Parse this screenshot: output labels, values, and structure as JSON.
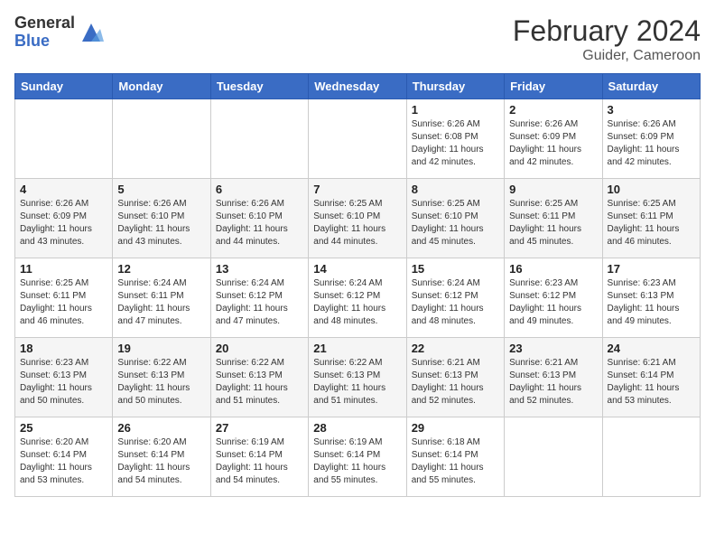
{
  "header": {
    "logo_general": "General",
    "logo_blue": "Blue",
    "title": "February 2024",
    "subtitle": "Guider, Cameroon"
  },
  "days_of_week": [
    "Sunday",
    "Monday",
    "Tuesday",
    "Wednesday",
    "Thursday",
    "Friday",
    "Saturday"
  ],
  "weeks": [
    [
      {
        "day": "",
        "info": ""
      },
      {
        "day": "",
        "info": ""
      },
      {
        "day": "",
        "info": ""
      },
      {
        "day": "",
        "info": ""
      },
      {
        "day": "1",
        "info": "Sunrise: 6:26 AM\nSunset: 6:08 PM\nDaylight: 11 hours\nand 42 minutes."
      },
      {
        "day": "2",
        "info": "Sunrise: 6:26 AM\nSunset: 6:09 PM\nDaylight: 11 hours\nand 42 minutes."
      },
      {
        "day": "3",
        "info": "Sunrise: 6:26 AM\nSunset: 6:09 PM\nDaylight: 11 hours\nand 42 minutes."
      }
    ],
    [
      {
        "day": "4",
        "info": "Sunrise: 6:26 AM\nSunset: 6:09 PM\nDaylight: 11 hours\nand 43 minutes."
      },
      {
        "day": "5",
        "info": "Sunrise: 6:26 AM\nSunset: 6:10 PM\nDaylight: 11 hours\nand 43 minutes."
      },
      {
        "day": "6",
        "info": "Sunrise: 6:26 AM\nSunset: 6:10 PM\nDaylight: 11 hours\nand 44 minutes."
      },
      {
        "day": "7",
        "info": "Sunrise: 6:25 AM\nSunset: 6:10 PM\nDaylight: 11 hours\nand 44 minutes."
      },
      {
        "day": "8",
        "info": "Sunrise: 6:25 AM\nSunset: 6:10 PM\nDaylight: 11 hours\nand 45 minutes."
      },
      {
        "day": "9",
        "info": "Sunrise: 6:25 AM\nSunset: 6:11 PM\nDaylight: 11 hours\nand 45 minutes."
      },
      {
        "day": "10",
        "info": "Sunrise: 6:25 AM\nSunset: 6:11 PM\nDaylight: 11 hours\nand 46 minutes."
      }
    ],
    [
      {
        "day": "11",
        "info": "Sunrise: 6:25 AM\nSunset: 6:11 PM\nDaylight: 11 hours\nand 46 minutes."
      },
      {
        "day": "12",
        "info": "Sunrise: 6:24 AM\nSunset: 6:11 PM\nDaylight: 11 hours\nand 47 minutes."
      },
      {
        "day": "13",
        "info": "Sunrise: 6:24 AM\nSunset: 6:12 PM\nDaylight: 11 hours\nand 47 minutes."
      },
      {
        "day": "14",
        "info": "Sunrise: 6:24 AM\nSunset: 6:12 PM\nDaylight: 11 hours\nand 48 minutes."
      },
      {
        "day": "15",
        "info": "Sunrise: 6:24 AM\nSunset: 6:12 PM\nDaylight: 11 hours\nand 48 minutes."
      },
      {
        "day": "16",
        "info": "Sunrise: 6:23 AM\nSunset: 6:12 PM\nDaylight: 11 hours\nand 49 minutes."
      },
      {
        "day": "17",
        "info": "Sunrise: 6:23 AM\nSunset: 6:13 PM\nDaylight: 11 hours\nand 49 minutes."
      }
    ],
    [
      {
        "day": "18",
        "info": "Sunrise: 6:23 AM\nSunset: 6:13 PM\nDaylight: 11 hours\nand 50 minutes."
      },
      {
        "day": "19",
        "info": "Sunrise: 6:22 AM\nSunset: 6:13 PM\nDaylight: 11 hours\nand 50 minutes."
      },
      {
        "day": "20",
        "info": "Sunrise: 6:22 AM\nSunset: 6:13 PM\nDaylight: 11 hours\nand 51 minutes."
      },
      {
        "day": "21",
        "info": "Sunrise: 6:22 AM\nSunset: 6:13 PM\nDaylight: 11 hours\nand 51 minutes."
      },
      {
        "day": "22",
        "info": "Sunrise: 6:21 AM\nSunset: 6:13 PM\nDaylight: 11 hours\nand 52 minutes."
      },
      {
        "day": "23",
        "info": "Sunrise: 6:21 AM\nSunset: 6:13 PM\nDaylight: 11 hours\nand 52 minutes."
      },
      {
        "day": "24",
        "info": "Sunrise: 6:21 AM\nSunset: 6:14 PM\nDaylight: 11 hours\nand 53 minutes."
      }
    ],
    [
      {
        "day": "25",
        "info": "Sunrise: 6:20 AM\nSunset: 6:14 PM\nDaylight: 11 hours\nand 53 minutes."
      },
      {
        "day": "26",
        "info": "Sunrise: 6:20 AM\nSunset: 6:14 PM\nDaylight: 11 hours\nand 54 minutes."
      },
      {
        "day": "27",
        "info": "Sunrise: 6:19 AM\nSunset: 6:14 PM\nDaylight: 11 hours\nand 54 minutes."
      },
      {
        "day": "28",
        "info": "Sunrise: 6:19 AM\nSunset: 6:14 PM\nDaylight: 11 hours\nand 55 minutes."
      },
      {
        "day": "29",
        "info": "Sunrise: 6:18 AM\nSunset: 6:14 PM\nDaylight: 11 hours\nand 55 minutes."
      },
      {
        "day": "",
        "info": ""
      },
      {
        "day": "",
        "info": ""
      }
    ]
  ]
}
